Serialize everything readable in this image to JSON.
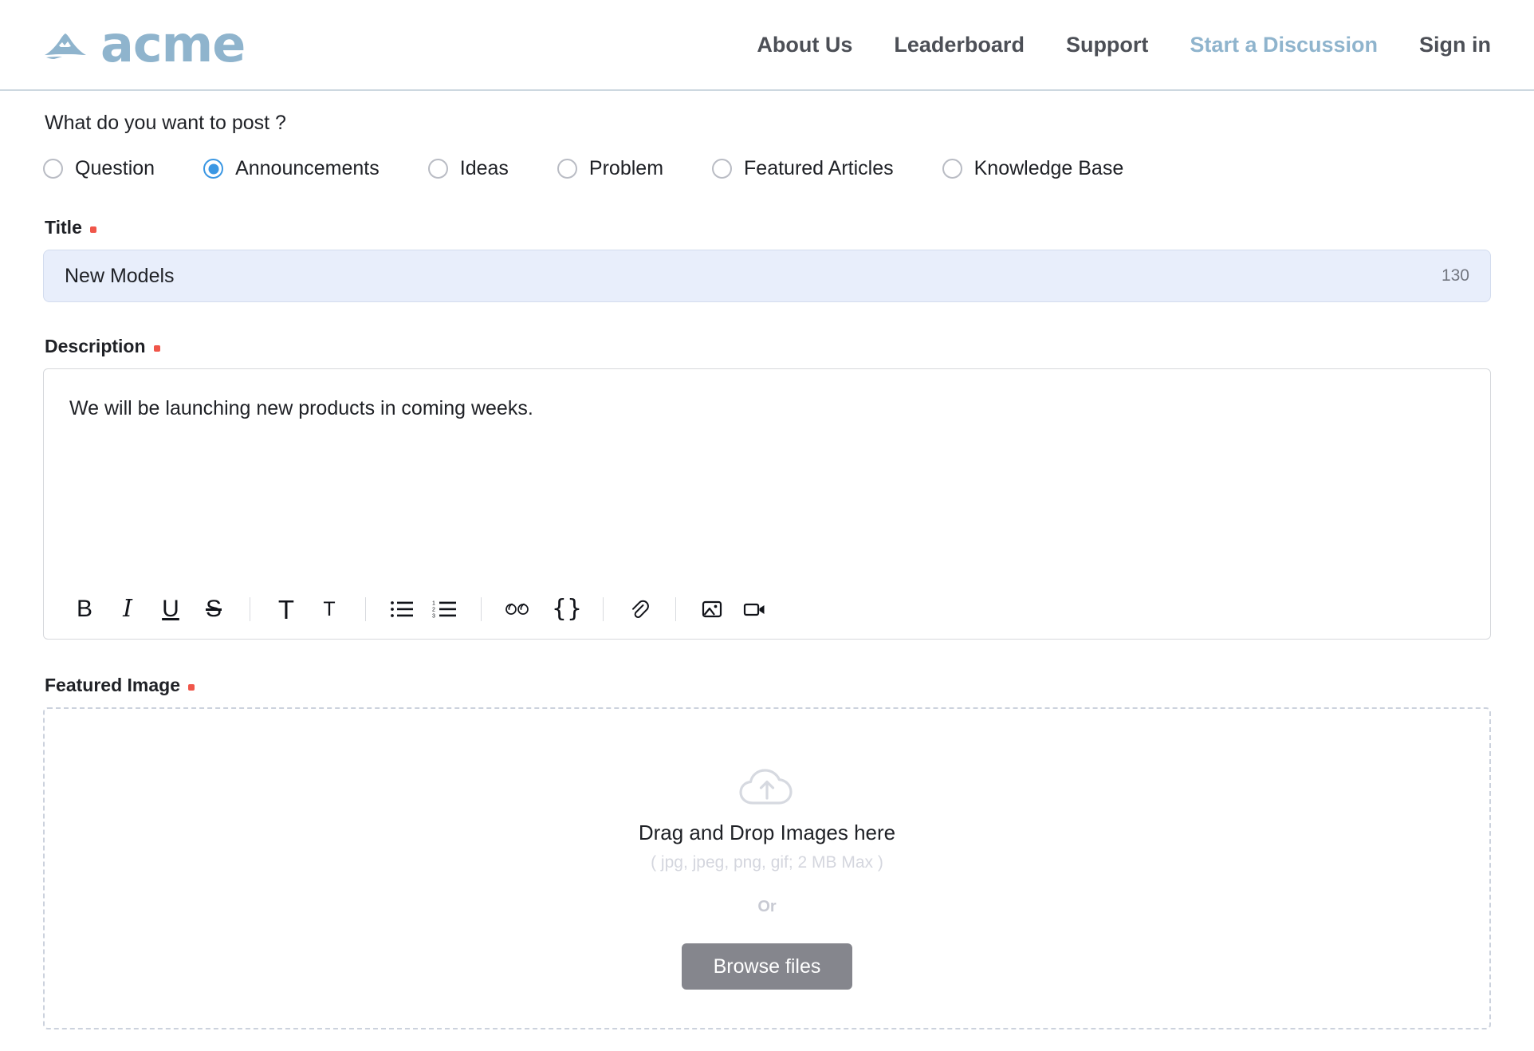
{
  "header": {
    "logo_icon": "mountain-icon",
    "brand_name": "acme",
    "nav": [
      {
        "label": "About Us",
        "active": false
      },
      {
        "label": "Leaderboard",
        "active": false
      },
      {
        "label": "Support",
        "active": false
      },
      {
        "label": "Start a Discussion",
        "active": true
      },
      {
        "label": "Sign in",
        "active": false
      }
    ],
    "active_color": "#8fb4cd",
    "brand_color": "#8fb4cd"
  },
  "form": {
    "post_type_question": "What do you want to post ?",
    "post_types": [
      {
        "label": "Question",
        "checked": false
      },
      {
        "label": "Announcements",
        "checked": true
      },
      {
        "label": "Ideas",
        "checked": false
      },
      {
        "label": "Problem",
        "checked": false
      },
      {
        "label": "Featured Articles",
        "checked": false
      },
      {
        "label": "Knowledge Base",
        "checked": false
      }
    ],
    "accent_color": "#3b97e3",
    "required_color": "#f0564a",
    "title": {
      "label": "Title",
      "required": true,
      "value": "New Models",
      "placeholder": "Title",
      "char_count": "130",
      "focused_bg": "#e8eefb"
    },
    "description": {
      "label": "Description",
      "required": true,
      "value": "We will be launching new products in coming weeks.",
      "placeholder": "Description",
      "toolbar": [
        {
          "name": "bold-icon",
          "glyph": "B",
          "kind": "b"
        },
        {
          "name": "italic-icon",
          "glyph": "I",
          "kind": "i"
        },
        {
          "name": "underline-icon",
          "glyph": "U",
          "kind": "u"
        },
        {
          "name": "strikethrough-icon",
          "glyph": "S",
          "kind": "s"
        },
        {
          "name": "separator",
          "kind": "sep"
        },
        {
          "name": "font-size-large-icon",
          "glyph": "T",
          "kind": "t-lg"
        },
        {
          "name": "font-size-small-icon",
          "glyph": "T",
          "kind": "t-sm"
        },
        {
          "name": "separator",
          "kind": "sep"
        },
        {
          "name": "bullet-list-icon",
          "kind": "svg-bullet"
        },
        {
          "name": "numbered-list-icon",
          "kind": "svg-number"
        },
        {
          "name": "separator",
          "kind": "sep"
        },
        {
          "name": "blockquote-icon",
          "glyph": "ɕɕ",
          "kind": "quote"
        },
        {
          "name": "code-block-icon",
          "glyph": "{}",
          "kind": "brace"
        },
        {
          "name": "separator",
          "kind": "sep"
        },
        {
          "name": "attach-link-icon",
          "kind": "svg-link"
        },
        {
          "name": "separator",
          "kind": "sep"
        },
        {
          "name": "insert-image-icon",
          "kind": "svg-image"
        },
        {
          "name": "insert-video-icon",
          "kind": "svg-video"
        }
      ]
    },
    "featured_image": {
      "label": "Featured Image",
      "required": true,
      "upload_icon": "cloud-upload-icon",
      "drop_title": "Drag and Drop Images here",
      "file_hint": "( jpg, jpeg, png, gif; 2 MB Max )",
      "or_text": "Or",
      "browse_label": "Browse files",
      "browse_color": "#85868d"
    }
  }
}
